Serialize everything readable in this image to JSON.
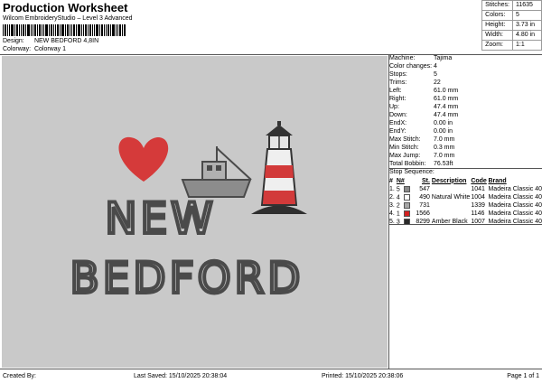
{
  "header": {
    "title": "Production Worksheet",
    "subtitle": "Wilcom EmbroideryStudio – Level 3 Advanced",
    "design_label": "Design:",
    "design_value": "NEW BEDFORD 4,8IN",
    "colorway_label": "Colorway:",
    "colorway_value": "Colorway 1"
  },
  "summary": {
    "rows": [
      {
        "label": "Stitches:",
        "value": "11635"
      },
      {
        "label": "Colors:",
        "value": "5"
      },
      {
        "label": "Height:",
        "value": "3.73 in"
      },
      {
        "label": "Width:",
        "value": "4.80 in"
      },
      {
        "label": "Zoom:",
        "value": "1:1"
      }
    ]
  },
  "design": {
    "line1": "NEW",
    "line2": "BEDFORD",
    "colors": {
      "canvas": "#c9c9c9",
      "heart": "#d53a3a",
      "text": "#4a4a4a",
      "boat": "#8c8c8c",
      "lighthouse_red": "#d23a3a",
      "lighthouse_base": "#2f2f2f"
    }
  },
  "details": {
    "rows": [
      {
        "label": "Machine:",
        "value": "Tajima"
      },
      {
        "label": "Color changes:",
        "value": "4"
      },
      {
        "label": "Stops:",
        "value": "5"
      },
      {
        "label": "Trims:",
        "value": "22"
      },
      {
        "label": "Left:",
        "value": "61.0 mm"
      },
      {
        "label": "Right:",
        "value": "61.0 mm"
      },
      {
        "label": "Up:",
        "value": "47.4 mm"
      },
      {
        "label": "Down:",
        "value": "47.4 mm"
      },
      {
        "label": "EndX:",
        "value": "0.00 in"
      },
      {
        "label": "EndY:",
        "value": "0.00 in"
      },
      {
        "label": "Max Stitch:",
        "value": "7.0 mm"
      },
      {
        "label": "Min Stitch:",
        "value": "0.3 mm"
      },
      {
        "label": "Max Jump:",
        "value": "7.0 mm"
      },
      {
        "label": "Total Bobbin:",
        "value": "76.53ft"
      }
    ]
  },
  "stop_sequence": {
    "title": "Stop Sequence:",
    "columns": [
      "#",
      "N#",
      "St.",
      "Description",
      "Code",
      "Brand"
    ],
    "rows": [
      {
        "num": "1.",
        "n": "5",
        "color": "#8a8a8a",
        "st": "547",
        "desc": "",
        "code": "1041",
        "brand": "Madeira Classic 40"
      },
      {
        "num": "2.",
        "n": "4",
        "color": "#ffffff",
        "st": "490",
        "desc": "Natural White",
        "code": "1004",
        "brand": "Madeira Classic 40"
      },
      {
        "num": "3.",
        "n": "2",
        "color": "#a6a6a6",
        "st": "731",
        "desc": "",
        "code": "1339",
        "brand": "Madeira Classic 40"
      },
      {
        "num": "4.",
        "n": "1",
        "color": "#d32020",
        "st": "1566",
        "desc": "",
        "code": "1146",
        "brand": "Madeira Classic 40"
      },
      {
        "num": "5.",
        "n": "3",
        "color": "#2a2a2a",
        "st": "8299",
        "desc": "Amber Black",
        "code": "1007",
        "brand": "Madeira Classic 40"
      }
    ]
  },
  "footer": {
    "created_by": "Created By:",
    "last_saved": "Last Saved: 15/10/2025 20:38:04",
    "printed": "Printed: 15/10/2025 20:38:06",
    "page": "Page 1 of 1"
  }
}
